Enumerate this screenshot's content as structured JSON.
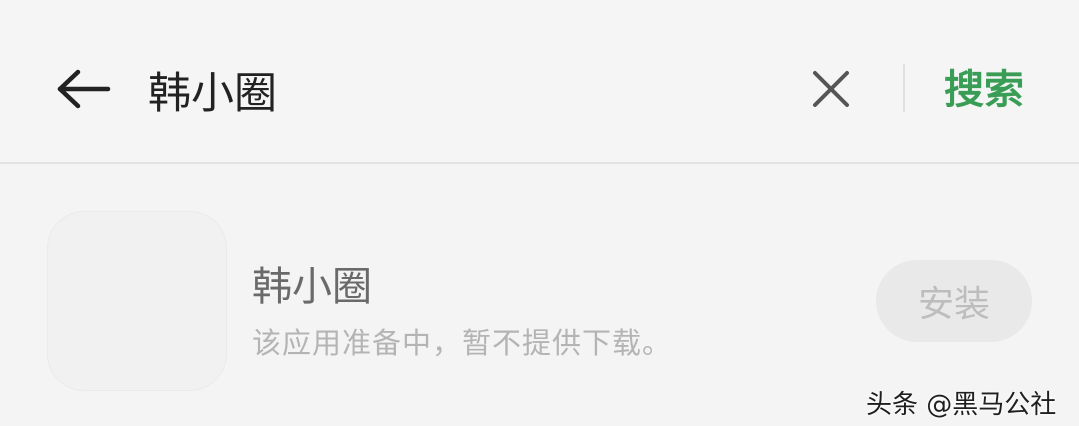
{
  "search_bar": {
    "back_icon": "arrow-left-icon",
    "query": "韩小圈",
    "clear_icon": "close-icon",
    "search_label": "搜索",
    "accent_color": "#3a9d55"
  },
  "result": {
    "app_name": "韩小圈",
    "description": "该应用准备中，暂不提供下载。",
    "install_label": "安装"
  },
  "watermark": {
    "text": "头条 @黑马公社"
  }
}
